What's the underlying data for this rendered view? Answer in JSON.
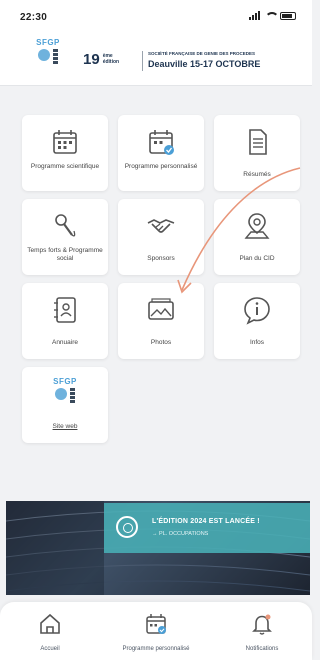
{
  "status_bar": {
    "time": "22:30"
  },
  "header": {
    "logo_text": "SFGP",
    "edition_number": "19",
    "edition_sup_line1": "ème",
    "edition_sup_line2": "édition",
    "organization": "SOCIÉTÉ FRANÇAISE DE GENIE DES PROCEDES",
    "dates": "Deauville 15-17 OCTOBRE"
  },
  "tiles": [
    {
      "label": "Programme scientifique",
      "icon": "calendar-icon"
    },
    {
      "label": "Programme personnalisé",
      "icon": "calendar-check-icon"
    },
    {
      "label": "Résumés",
      "icon": "document-icon"
    },
    {
      "label": "Temps forts & Programme social",
      "icon": "microphone-icon"
    },
    {
      "label": "Sponsors",
      "icon": "handshake-icon"
    },
    {
      "label": "Plan du CID",
      "icon": "map-icon"
    },
    {
      "label": "Annuaire",
      "icon": "address-book-icon"
    },
    {
      "label": "Photos",
      "icon": "photo-icon"
    },
    {
      "label": "Infos",
      "icon": "info-icon"
    },
    {
      "label": "Site web",
      "icon": "website-logo-icon",
      "logo_text": "SFGP"
    }
  ],
  "banner": {
    "title": "L'ÉDITION 2024 EST LANCÉE !",
    "subtitle": "→ PL. OCCUPATIONS"
  },
  "bottom_nav": [
    {
      "label": "Accueil",
      "icon": "home-icon"
    },
    {
      "label": "Programme personnalisé",
      "icon": "calendar-check-icon"
    },
    {
      "label": "Notifications",
      "icon": "bell-icon"
    }
  ],
  "colors": {
    "accent_blue": "#4b9fd6",
    "navy": "#1e3450",
    "teal_banner": "#48aab2",
    "annotation_arrow": "#e8967a"
  }
}
